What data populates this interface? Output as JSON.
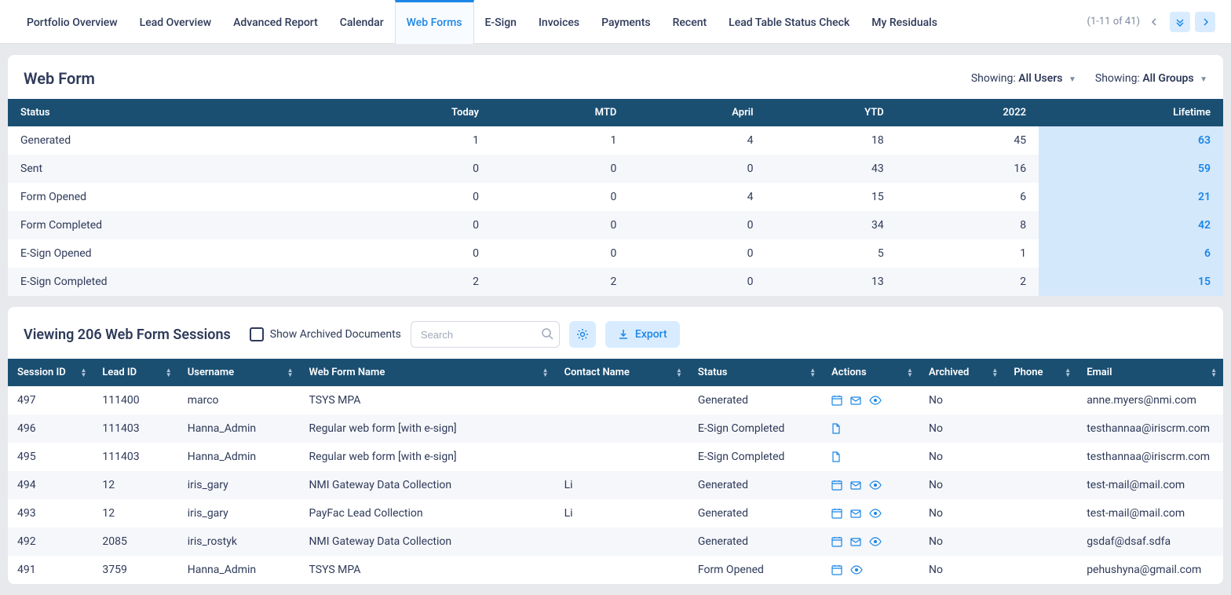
{
  "tabs": [
    "Portfolio Overview",
    "Lead Overview",
    "Advanced Report",
    "Calendar",
    "Web Forms",
    "E-Sign",
    "Invoices",
    "Payments",
    "Recent",
    "Lead Table Status Check",
    "My Residuals"
  ],
  "active_tab_index": 4,
  "pager": {
    "text": "(1-11 of 41)"
  },
  "webform_panel": {
    "title": "Web Form",
    "users_label": "Showing:",
    "users_value": "All Users",
    "groups_label": "Showing:",
    "groups_value": "All Groups",
    "columns": [
      "Status",
      "Today",
      "MTD",
      "April",
      "YTD",
      "2022",
      "Lifetime"
    ],
    "rows": [
      {
        "status": "Generated",
        "today": "1",
        "mtd": "1",
        "april": "4",
        "ytd": "18",
        "y2022": "45",
        "lifetime": "63"
      },
      {
        "status": "Sent",
        "today": "0",
        "mtd": "0",
        "april": "0",
        "ytd": "43",
        "y2022": "16",
        "lifetime": "59"
      },
      {
        "status": "Form Opened",
        "today": "0",
        "mtd": "0",
        "april": "4",
        "ytd": "15",
        "y2022": "6",
        "lifetime": "21"
      },
      {
        "status": "Form Completed",
        "today": "0",
        "mtd": "0",
        "april": "0",
        "ytd": "34",
        "y2022": "8",
        "lifetime": "42"
      },
      {
        "status": "E-Sign Opened",
        "today": "0",
        "mtd": "0",
        "april": "0",
        "ytd": "5",
        "y2022": "1",
        "lifetime": "6"
      },
      {
        "status": "E-Sign Completed",
        "today": "2",
        "mtd": "2",
        "april": "0",
        "ytd": "13",
        "y2022": "2",
        "lifetime": "15"
      }
    ]
  },
  "sessions_panel": {
    "title": "Viewing 206 Web Form Sessions",
    "show_archived_label": "Show Archived Documents",
    "search_placeholder": "Search",
    "export_label": "Export",
    "columns": [
      "Session ID",
      "Lead ID",
      "Username",
      "Web Form Name",
      "Contact Name",
      "Status",
      "Actions",
      "Archived",
      "Phone",
      "Email"
    ],
    "rows": [
      {
        "session": "497",
        "lead": "111400",
        "user": "marco",
        "form": "TSYS MPA",
        "contact": "",
        "status": "Generated",
        "status_class": "",
        "actions": [
          "calendar",
          "mail",
          "eye"
        ],
        "archived": "No",
        "phone": "",
        "email": "anne.myers@nmi.com"
      },
      {
        "session": "496",
        "lead": "111403",
        "user": "Hanna_Admin",
        "form": "Regular web form [with e-sign]",
        "contact": "",
        "status": "E-Sign Completed",
        "status_class": "green",
        "actions": [
          "doc"
        ],
        "archived": "No",
        "phone": "",
        "email": "testhannaa@iriscrm.com"
      },
      {
        "session": "495",
        "lead": "111403",
        "user": "Hanna_Admin",
        "form": "Regular web form [with e-sign]",
        "contact": "",
        "status": "E-Sign Completed",
        "status_class": "green",
        "actions": [
          "doc"
        ],
        "archived": "No",
        "phone": "",
        "email": "testhannaa@iriscrm.com"
      },
      {
        "session": "494",
        "lead": "12",
        "user": "iris_gary",
        "form": "NMI Gateway Data Collection",
        "contact": "Li",
        "status": "Generated",
        "status_class": "",
        "actions": [
          "calendar",
          "mail",
          "eye"
        ],
        "archived": "No",
        "phone": "",
        "email": "test-mail@mail.com"
      },
      {
        "session": "493",
        "lead": "12",
        "user": "iris_gary",
        "form": "PayFac Lead Collection",
        "contact": "Li",
        "status": "Generated",
        "status_class": "",
        "actions": [
          "calendar",
          "mail",
          "eye"
        ],
        "archived": "No",
        "phone": "",
        "email": "test-mail@mail.com"
      },
      {
        "session": "492",
        "lead": "2085",
        "user": "iris_rostyk",
        "form": "NMI Gateway Data Collection",
        "contact": "",
        "status": "Generated",
        "status_class": "",
        "actions": [
          "calendar",
          "mail",
          "eye"
        ],
        "archived": "No",
        "phone": "",
        "email": "gsdaf@dsaf.sdfa"
      },
      {
        "session": "491",
        "lead": "3759",
        "user": "Hanna_Admin",
        "form": "TSYS MPA",
        "contact": "",
        "status": "Form Opened",
        "status_class": "red",
        "actions": [
          "calendar",
          "eye"
        ],
        "archived": "No",
        "phone": "",
        "email": "pehushyna@gmail.com"
      }
    ]
  }
}
